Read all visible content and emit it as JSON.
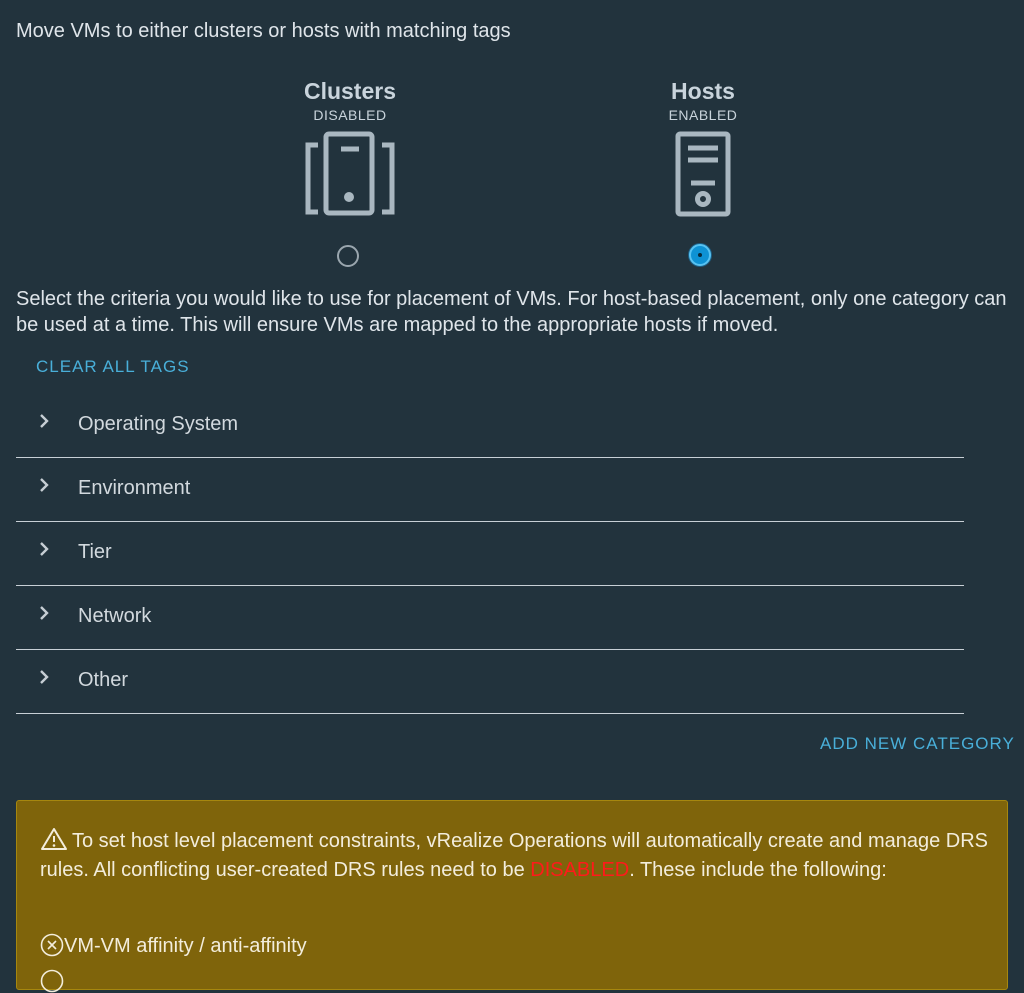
{
  "intro_text": "Move VMs to either clusters or hosts with matching tags",
  "targets": {
    "clusters": {
      "title": "Clusters",
      "status": "DISABLED",
      "selected": false
    },
    "hosts": {
      "title": "Hosts",
      "status": "ENABLED",
      "selected": true
    }
  },
  "description": "Select the criteria you would like to use for placement of VMs. For host-based placement, only one category can be used at a time. This will ensure VMs are mapped to the appropriate hosts if moved.",
  "clear_all_label": "CLEAR ALL TAGS",
  "categories": [
    {
      "label": "Operating System"
    },
    {
      "label": "Environment"
    },
    {
      "label": "Tier"
    },
    {
      "label": "Network"
    },
    {
      "label": "Other"
    }
  ],
  "add_category_label": "ADD NEW CATEGORY",
  "warning": {
    "text_before": "To set host level placement constraints, vRealize Operations will automatically create and manage DRS rules. All conflicting user-created DRS rules need to be ",
    "highlight": "DISABLED",
    "text_after": ". These include the following:",
    "items": [
      {
        "label": "VM-VM affinity / anti-affinity"
      }
    ]
  },
  "colors": {
    "background": "#22333d",
    "link": "#49afd9",
    "radio_selected": "#0e92d4",
    "warning_bg": "#7f640b",
    "disabled_red": "#ff1a1a"
  }
}
